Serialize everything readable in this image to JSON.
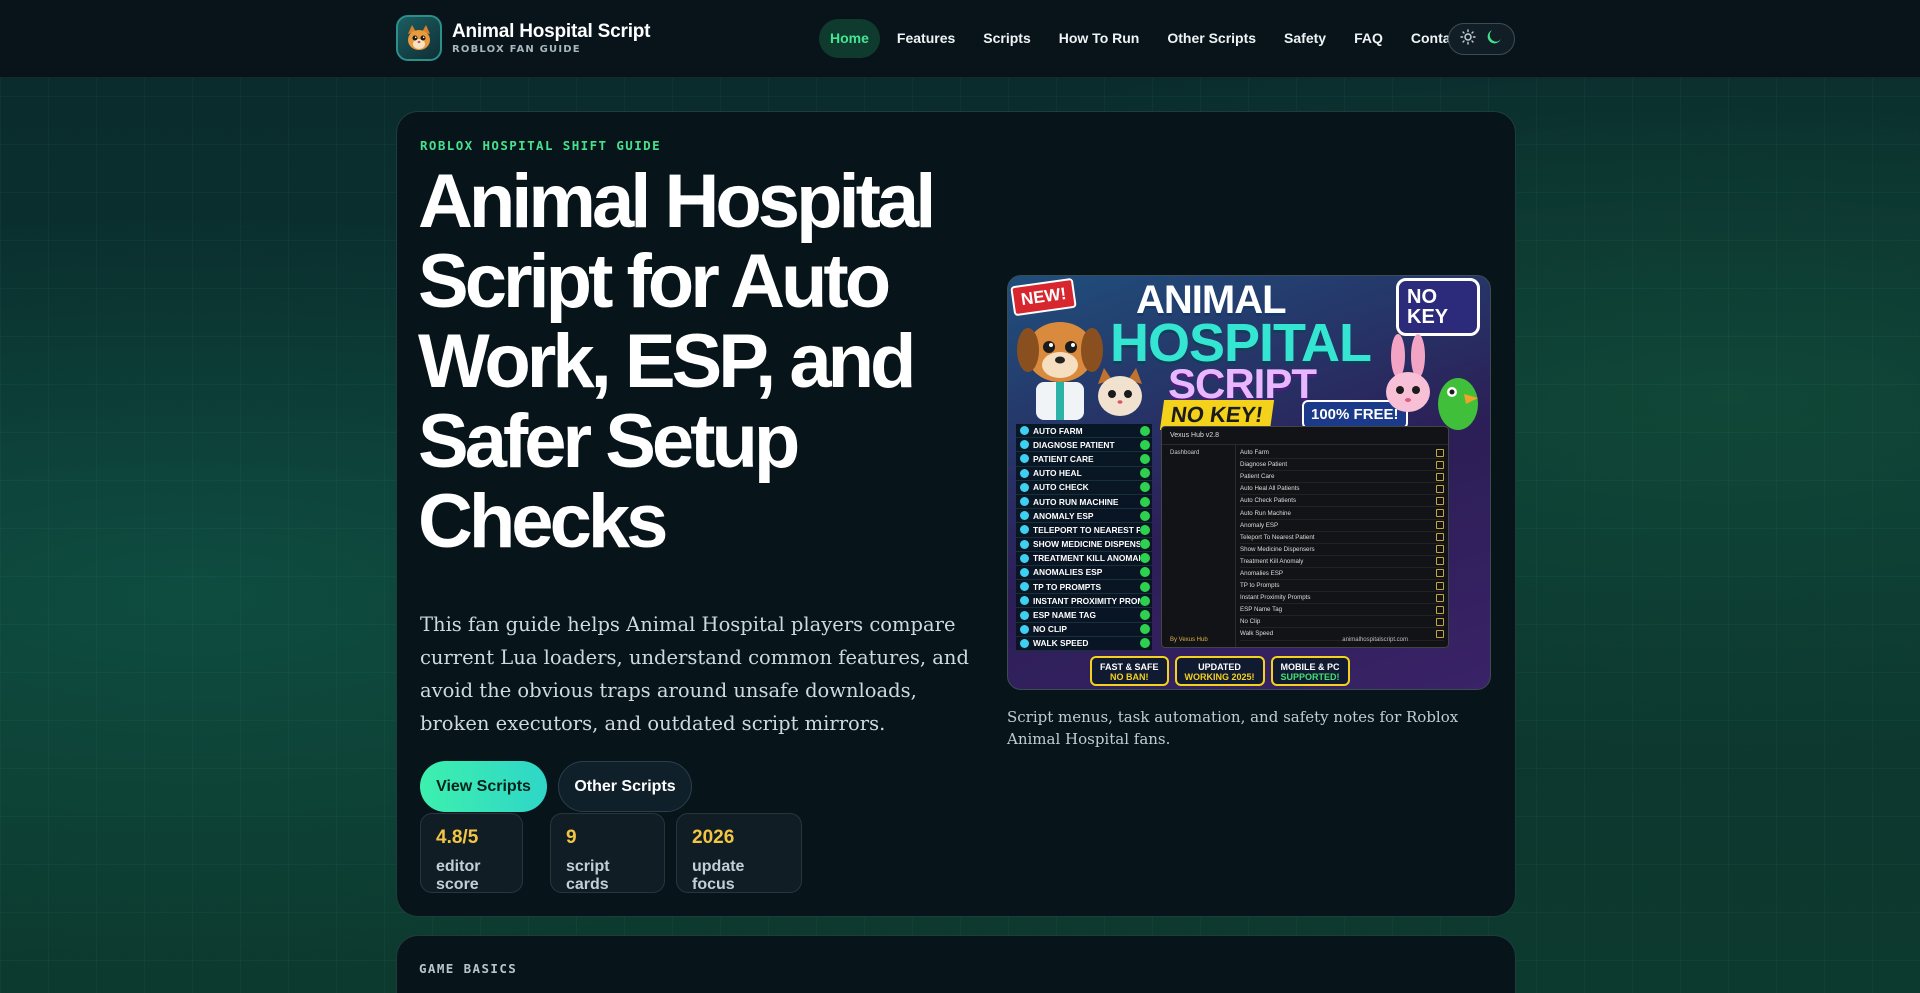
{
  "brand": {
    "title": "Animal Hospital Script",
    "subtitle": "ROBLOX FAN GUIDE",
    "logo_icon": "cat-face-icon"
  },
  "nav": {
    "items": [
      {
        "label": "Home",
        "active": true
      },
      {
        "label": "Features",
        "active": false
      },
      {
        "label": "Scripts",
        "active": false
      },
      {
        "label": "How To Run",
        "active": false
      },
      {
        "label": "Other Scripts",
        "active": false
      },
      {
        "label": "Safety",
        "active": false
      },
      {
        "label": "FAQ",
        "active": false
      },
      {
        "label": "Contact",
        "active": false
      }
    ],
    "theme_toggle": {
      "light_icon": "sun-icon",
      "dark_icon": "moon-icon",
      "selected": "dark"
    }
  },
  "hero": {
    "eyebrow": "ROBLOX HOSPITAL SHIFT GUIDE",
    "title": "Animal Hospital Script for Auto Work, ESP, and Safer Setup Checks",
    "description": "This fan guide helps Animal Hospital players compare current Lua loaders, understand common features, and avoid the obvious traps around unsafe downloads, broken executors, and outdated script mirrors.",
    "primary_button": "View Scripts",
    "secondary_button": "Other Scripts",
    "stats": [
      {
        "value": "4.8/5",
        "label": "editor score"
      },
      {
        "value": "9",
        "label": "script cards"
      },
      {
        "value": "2026",
        "label": "update focus"
      }
    ],
    "image_caption": "Script menus, task automation, and safety notes for Roblox Animal Hospital fans."
  },
  "promo_image": {
    "new_tag": "NEW!",
    "title_line1": "ANIMAL",
    "title_line2": "HOSPITAL",
    "title_line3": "SCRIPT",
    "no_key": "NO KEY!",
    "free": "100% FREE!",
    "lock_badge": "NO KEY",
    "feature_list": [
      "AUTO FARM",
      "DIAGNOSE PATIENT",
      "PATIENT CARE",
      "AUTO HEAL",
      "AUTO CHECK",
      "AUTO RUN MACHINE",
      "ANOMALY ESP",
      "TELEPORT TO NEAREST PATIENT",
      "SHOW MEDICINE DISPENSERS",
      "TREATMENT KILL ANOMALY",
      "ANOMALIES ESP",
      "TP TO PROMPTS",
      "INSTANT PROXIMITY PROMPTS",
      "ESP NAME TAG",
      "NO CLIP",
      "WALK SPEED"
    ],
    "window_title": "Vexus Hub v2.8",
    "window_sidebar": "Dashboard",
    "window_items": [
      "Auto Farm",
      "Diagnose Patient",
      "Patient Care",
      "Auto Heal All Patients",
      "Auto Check Patients",
      "Auto Run Machine",
      "Anomaly ESP",
      "Teleport To Nearest Patient",
      "Show Medicine Dispensers",
      "Treatment Kill Anomaly",
      "Anomalies ESP",
      "TP to Prompts",
      "Instant Proximity Prompts",
      "ESP Name Tag",
      "No Clip",
      "Walk Speed"
    ],
    "window_footer_left": "By Vexus Hub",
    "window_footer_right": "animalhospitalscript.com",
    "badges": [
      {
        "top": "FAST & SAFE",
        "bottom": "NO BAN!"
      },
      {
        "top": "UPDATED",
        "bottom": "WORKING 2025!"
      },
      {
        "top": "MOBILE & PC",
        "bottom": "SUPPORTED!"
      }
    ]
  },
  "basics": {
    "label": "GAME BASICS"
  },
  "colors": {
    "accent_green": "#46e494",
    "stat_yellow": "#f4c542",
    "card_bg": "#07151b",
    "nav_bg": "#08141a"
  }
}
